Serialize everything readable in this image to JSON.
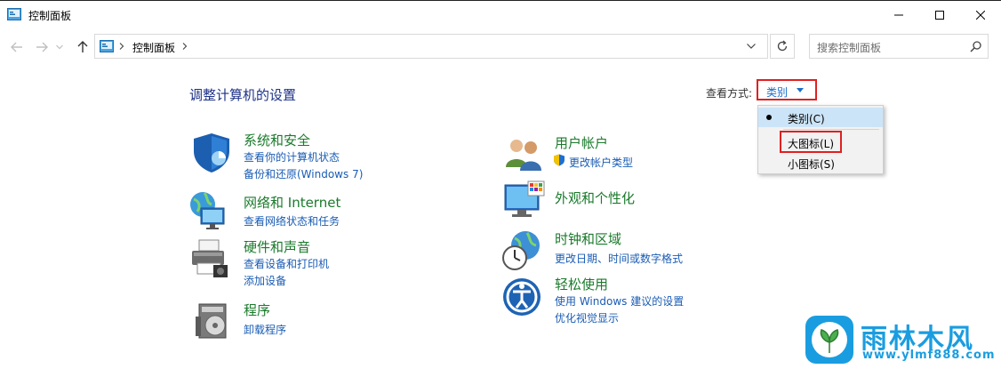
{
  "window": {
    "title": "控制面板"
  },
  "address": {
    "breadcrumb": "控制面板",
    "search_placeholder": "搜索控制面板"
  },
  "main": {
    "heading": "调整计算机的设置",
    "view_by_label": "查看方式:",
    "view_by_value": "类别"
  },
  "dropdown": {
    "options": [
      {
        "label": "类别(C)",
        "selected": true
      },
      {
        "label": "大图标(L)",
        "selected": false
      },
      {
        "label": "小图标(S)",
        "selected": false
      }
    ]
  },
  "categories_left": [
    {
      "title": "系统和安全",
      "icon": "shield-icon",
      "links": [
        "查看你的计算机状态",
        "备份和还原(Windows 7)"
      ]
    },
    {
      "title": "网络和 Internet",
      "icon": "network-globe-icon",
      "links": [
        "查看网络状态和任务"
      ]
    },
    {
      "title": "硬件和声音",
      "icon": "printer-icon",
      "links": [
        "查看设备和打印机",
        "添加设备"
      ]
    },
    {
      "title": "程序",
      "icon": "programs-disc-icon",
      "links": [
        "卸载程序"
      ]
    }
  ],
  "categories_right": [
    {
      "title": "用户帐户",
      "icon": "users-icon",
      "links": [
        "更改帐户类型"
      ]
    },
    {
      "title": "外观和个性化",
      "icon": "monitor-palette-icon",
      "links": []
    },
    {
      "title": "时钟和区域",
      "icon": "clock-globe-icon",
      "links": [
        "更改日期、时间或数字格式"
      ]
    },
    {
      "title": "轻松使用",
      "icon": "ease-of-access-icon",
      "links": [
        "使用 Windows 建议的设置",
        "优化视觉显示"
      ]
    }
  ],
  "watermark": {
    "text": "雨林木风",
    "url": "www.ylmf888.com"
  }
}
